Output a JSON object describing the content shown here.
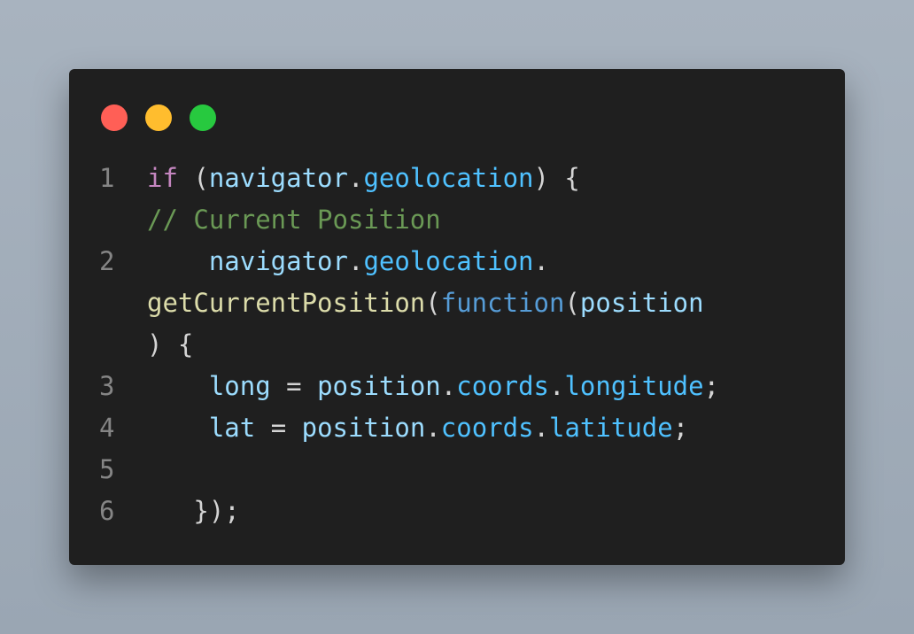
{
  "window": {
    "controls": [
      {
        "name": "close",
        "color": "#ff5f56"
      },
      {
        "name": "minimize",
        "color": "#ffbd2e"
      },
      {
        "name": "maximize",
        "color": "#27c93f"
      }
    ]
  },
  "code": {
    "lines": [
      {
        "number": "1",
        "segments": [
          {
            "t": "if",
            "c": "kw"
          },
          {
            "t": " (",
            "c": "pn"
          },
          {
            "t": "navigator",
            "c": "var"
          },
          {
            "t": ".",
            "c": "pn"
          },
          {
            "t": "geolocation",
            "c": "prop"
          },
          {
            "t": ") {",
            "c": "pn"
          }
        ]
      },
      {
        "number": "",
        "segments": [
          {
            "t": "// Current Position",
            "c": "cm"
          }
        ]
      },
      {
        "number": "2",
        "segments": [
          {
            "t": "    ",
            "c": "pn"
          },
          {
            "t": "navigator",
            "c": "var"
          },
          {
            "t": ".",
            "c": "pn"
          },
          {
            "t": "geolocation",
            "c": "prop"
          },
          {
            "t": ".",
            "c": "pn"
          }
        ]
      },
      {
        "number": "",
        "segments": [
          {
            "t": "getCurrentPosition",
            "c": "fn"
          },
          {
            "t": "(",
            "c": "pn"
          },
          {
            "t": "function",
            "c": "kw2"
          },
          {
            "t": "(",
            "c": "pn"
          },
          {
            "t": "position",
            "c": "var"
          }
        ]
      },
      {
        "number": "",
        "segments": [
          {
            "t": ") {",
            "c": "pn"
          }
        ]
      },
      {
        "number": "3",
        "segments": [
          {
            "t": "    ",
            "c": "pn"
          },
          {
            "t": "long",
            "c": "var"
          },
          {
            "t": " = ",
            "c": "pn"
          },
          {
            "t": "position",
            "c": "var"
          },
          {
            "t": ".",
            "c": "pn"
          },
          {
            "t": "coords",
            "c": "prop"
          },
          {
            "t": ".",
            "c": "pn"
          },
          {
            "t": "longitude",
            "c": "prop"
          },
          {
            "t": ";",
            "c": "pn"
          }
        ]
      },
      {
        "number": "4",
        "segments": [
          {
            "t": "    ",
            "c": "pn"
          },
          {
            "t": "lat",
            "c": "var"
          },
          {
            "t": " = ",
            "c": "pn"
          },
          {
            "t": "position",
            "c": "var"
          },
          {
            "t": ".",
            "c": "pn"
          },
          {
            "t": "coords",
            "c": "prop"
          },
          {
            "t": ".",
            "c": "pn"
          },
          {
            "t": "latitude",
            "c": "prop"
          },
          {
            "t": ";",
            "c": "pn"
          }
        ]
      },
      {
        "number": "5",
        "segments": []
      },
      {
        "number": "6",
        "segments": [
          {
            "t": "   });",
            "c": "pn"
          }
        ]
      }
    ]
  }
}
